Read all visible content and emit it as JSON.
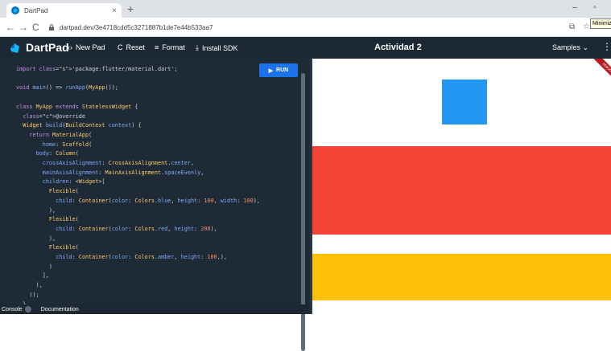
{
  "browser": {
    "tab_title": "DartPad",
    "tab_close": "×",
    "new_tab": "+",
    "url": "dartpad.dev/3e4718cdd5c3271887b1de7e44b533aa7",
    "tooltip": "Minimiz, ta",
    "minimize": "–",
    "maximize": "▫"
  },
  "header": {
    "brand": "DartPad",
    "new_pad": "New Pad",
    "reset": "Reset",
    "format": "Format",
    "install_sdk": "Install SDK",
    "title": "Actividad 2",
    "samples": "Samples"
  },
  "editor": {
    "run_label": "RUN",
    "code_lines": [
      "import 'package:flutter/material.dart';",
      "",
      "void main() => runApp(MyApp());",
      "",
      "class MyApp extends StatelessWidget {",
      "  @override",
      "  Widget build(BuildContext context) {",
      "    return MaterialApp(",
      "        home: Scaffold(",
      "      body: Column(",
      "        crossAxisAlignment: CrossAxisAlignment.center,",
      "        mainAxisAlignment: MainAxisAlignment.spaceEvenly,",
      "        children: <Widget>[",
      "          Flexible(",
      "            child: Container(color: Colors.blue, height: 100, width: 100),",
      "          ),",
      "          Flexible(",
      "            child: Container(color: Colors.red, height: 200),",
      "          ),",
      "          Flexible(",
      "            child: Container(color: Colors.amber, height: 100,),",
      "          )",
      "        ],",
      "      ),",
      "    ));",
      "  }",
      "}"
    ]
  },
  "bottom": {
    "console": "Console",
    "documentation": "Documentation"
  },
  "output": {
    "banner": "DEBUG",
    "colors": {
      "blue": "#2196f3",
      "red": "#f44336",
      "amber": "#ffc107"
    }
  }
}
